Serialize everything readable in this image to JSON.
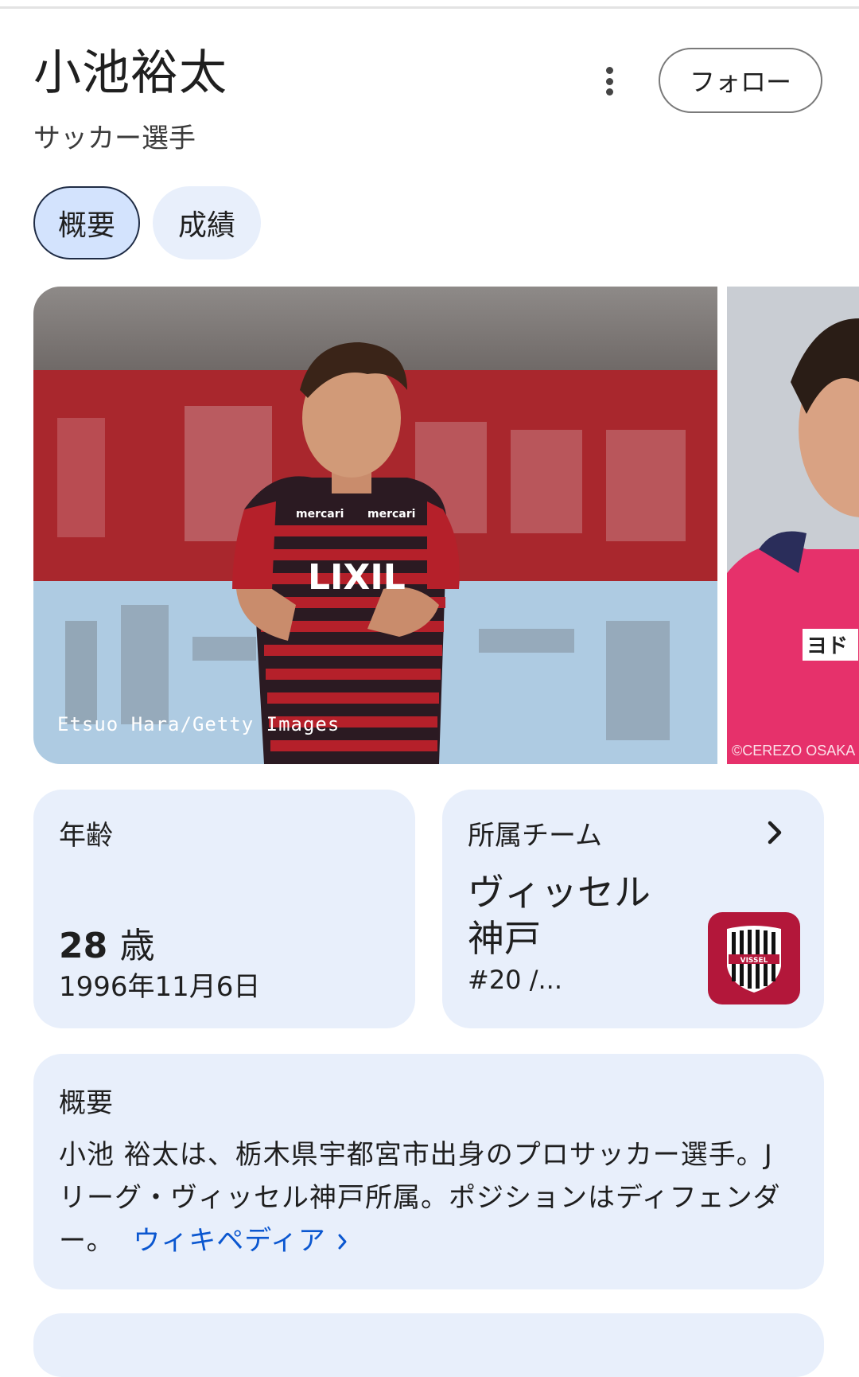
{
  "header": {
    "title": "小池裕太",
    "subtitle": "サッカー選手",
    "follow_label": "フォロー",
    "more_icon": "more-vert-icon"
  },
  "tabs": [
    {
      "label": "概要",
      "active": true
    },
    {
      "label": "成績",
      "active": false
    }
  ],
  "images": [
    {
      "credit": "Etsuo Hara/Getty Images"
    },
    {
      "credit": "©CEREZO OSAKA"
    }
  ],
  "age_card": {
    "label": "年齢",
    "value": "28",
    "unit": "歳",
    "birthdate": "1996年11月6日"
  },
  "team_card": {
    "label": "所属チーム",
    "team_name": "ヴィッセル神戸",
    "number": "#20 /...",
    "logo_text": "VISSEL",
    "icon": "chevron-right-icon"
  },
  "overview": {
    "label": "概要",
    "text": "小池 裕太は、栃木県宇都宮市出身のプロサッカー選手。Jリーグ・ヴィッセル神戸所属。ポジションはディフェンダー。",
    "link_label": "ウィキペディア"
  },
  "colors": {
    "card_bg": "#e8effb",
    "tab_active_bg": "#d3e3fd",
    "link": "#0b57d0",
    "team_logo": "#b3173a"
  }
}
